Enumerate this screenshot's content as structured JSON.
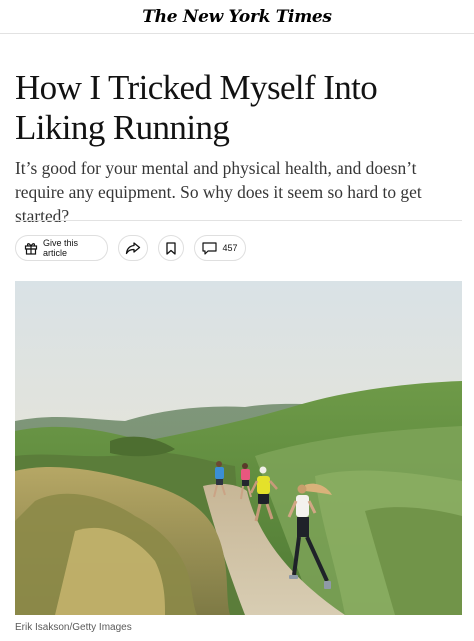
{
  "masthead": {
    "logo_text": "The New York Times"
  },
  "article": {
    "headline": "How I Tricked Myself Into Liking Running",
    "summary": "It’s good for your mental and physical health, and doesn’t require any equipment. So why does it seem so hard to get started?",
    "photo_credit": "Erik Isakson/Getty Images"
  },
  "actions": {
    "gift_label": "Give this article",
    "share_icon": "share-arrow-icon",
    "save_icon": "bookmark-icon",
    "comment_icon": "comment-bubble-icon",
    "comment_count": "457"
  },
  "colors": {
    "text": "#121212",
    "summary_text": "#363636",
    "border": "#dfdfdf"
  }
}
